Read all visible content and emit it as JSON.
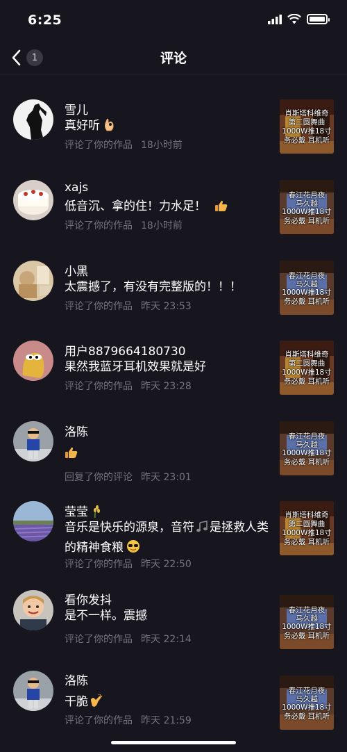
{
  "status_bar": {
    "time": "6:25",
    "icons": [
      "signal-icon",
      "wifi-icon",
      "battery-icon"
    ]
  },
  "nav": {
    "title": "评论",
    "back_count": "1"
  },
  "colors": {
    "background": "#17161f",
    "secondary_text": "#75747d",
    "divider": "#2b2a33"
  },
  "comments": [
    {
      "name": "雪儿",
      "text": "真好听",
      "emoji": "ok-hand-emoji",
      "action": "评论了你的作品",
      "time": "18小时前",
      "thumb": [
        "肖斯塔科维奇",
        "第二圆舞曲",
        "1000W推18寸",
        "务必戴   耳机听"
      ]
    },
    {
      "name": "xajs",
      "text": "低音沉、拿的住！力水足！",
      "emoji": "thumbs-up-emoji",
      "action": "评论了你的作品",
      "time": "18小时前",
      "thumb": [
        "春江花月夜",
        "马久越",
        "1000W推18寸",
        "务必戴   耳机听"
      ]
    },
    {
      "name": "小黑",
      "text": "太震撼了，有没有完整版的！！！",
      "action": "评论了你的作品",
      "time": "昨天 23:53",
      "thumb": [
        "春江花月夜",
        "马久越",
        "1000W推18寸",
        "务必戴   耳机听"
      ]
    },
    {
      "name": "用户8879664180730",
      "text": "果然我蓝牙耳机效果就是好",
      "action": "评论了你的作品",
      "time": "昨天 23:28",
      "thumb": [
        "肖斯塔科维奇",
        "第二圆舞曲",
        "1000W推18寸",
        "务必戴   耳机听"
      ]
    },
    {
      "name": "洛陈",
      "text": "",
      "emoji": "thumbs-up-emoji",
      "action": "回复了你的评论",
      "time": "昨天 23:01",
      "thumb": [
        "春江花月夜",
        "马久越",
        "1000W推18寸",
        "务必戴   耳机听"
      ]
    },
    {
      "name": "莹莹",
      "name_emoji": "rice-emoji",
      "text": "音乐是快乐的源泉，音符",
      "text2": "是拯救人类的精神食粮",
      "emoji": "sunglasses-emoji",
      "action": "评论了你的作品",
      "time": "昨天 22:50",
      "thumb": [
        "肖斯塔科维奇",
        "第二圆舞曲",
        "1000W推18寸",
        "务必戴   耳机听"
      ]
    },
    {
      "name": "看你发抖",
      "text": "是不一样。震撼",
      "action": "评论了你的作品",
      "time": "昨天 22:14",
      "thumb": [
        "春江花月夜",
        "马久越",
        "1000W推18寸",
        "务必戴   耳机听"
      ]
    },
    {
      "name": "洛陈",
      "text": "干脆",
      "emoji": "clapping-emoji",
      "action": "评论了你的作品",
      "time": "昨天 21:59",
      "thumb": [
        "春江花月夜",
        "马久越",
        "1000W推18寸",
        "务必戴   耳机听"
      ]
    }
  ]
}
